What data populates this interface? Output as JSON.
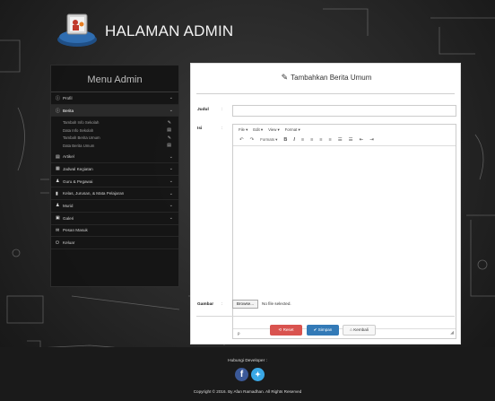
{
  "header": {
    "title": "HALAMAN ADMIN",
    "logo_icon": "admin-logo-icon"
  },
  "sidebar": {
    "title": "Menu Admin",
    "items": [
      {
        "label": "Profil",
        "icon": "info-icon",
        "glyph": "ⓘ"
      },
      {
        "label": "Berita",
        "icon": "info-icon",
        "glyph": "ⓘ",
        "active": true,
        "sub": [
          {
            "label": "Tambah Info Sekolah",
            "icon": "pencil-icon",
            "glyph": "✎"
          },
          {
            "label": "Data Info Sekolah",
            "icon": "table-icon",
            "glyph": "▤"
          },
          {
            "label": "Tambah Berita Umum",
            "icon": "pencil-icon",
            "glyph": "✎"
          },
          {
            "label": "Data Berita Umum",
            "icon": "table-icon",
            "glyph": "▤"
          }
        ]
      },
      {
        "label": "Artikel",
        "icon": "list-icon",
        "glyph": "▤"
      },
      {
        "label": "Jadwal Kegiatan",
        "icon": "calendar-icon",
        "glyph": "▦"
      },
      {
        "label": "Guru & Pegawai",
        "icon": "user-icon",
        "glyph": "♟"
      },
      {
        "label": "Kelas, Jurusan, & Mata Pelajaran",
        "icon": "bookmark-icon",
        "glyph": "▮"
      },
      {
        "label": "Murid",
        "icon": "user-icon",
        "glyph": "♟"
      },
      {
        "label": "Galeri",
        "icon": "image-icon",
        "glyph": "▣"
      },
      {
        "label": "Pesan Masuk",
        "icon": "mail-icon",
        "glyph": "✉"
      },
      {
        "label": "Keluar",
        "icon": "power-icon",
        "glyph": "⏻"
      }
    ]
  },
  "form": {
    "title": "Tambahkan Berita Umum",
    "judul_label": "Judul",
    "isi_label": "Isi",
    "gambar_label": "Gambar",
    "colon": ":",
    "judul_value": "",
    "editor_menu": [
      "File",
      "Edit",
      "View",
      "Format"
    ],
    "editor_formats": "Formats",
    "editor_status": "p",
    "browse_label": "Browse...",
    "file_status": "No file selected.",
    "reset_label": "Reset",
    "simpan_label": "Simpan",
    "kembali_label": "Kembali"
  },
  "footer": {
    "contact_label": "Hubungi Developer :",
    "copyright": "Copyright © 2016. By Afan Ramadhan. All Rights Reserved"
  },
  "colors": {
    "reset": "#d9534f",
    "simpan": "#337ab7",
    "facebook": "#3b5998",
    "twitter": "#3aa8e6"
  }
}
